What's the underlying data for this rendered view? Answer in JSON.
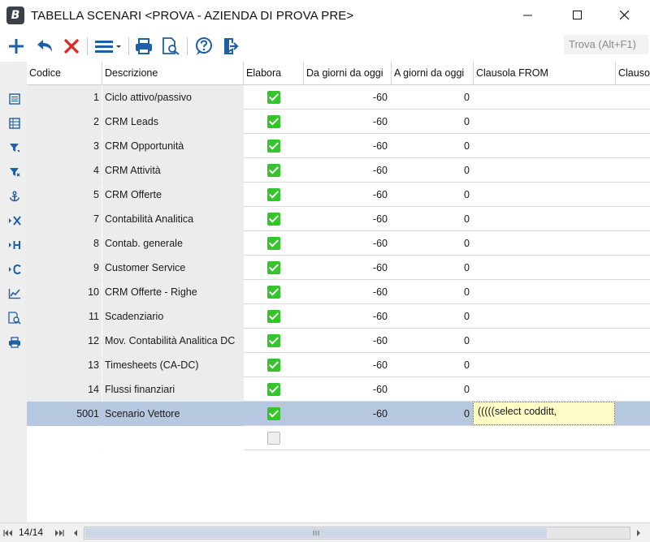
{
  "window": {
    "app_icon": "B",
    "title": "TABELLA SCENARI <PROVA - AZIENDA DI PROVA PRE>"
  },
  "toolbar": {
    "search_label": "Trova (Alt+F1)",
    "icons": [
      "add-icon",
      "undo-icon",
      "delete-icon",
      "menu-icon",
      "print-icon",
      "preview-icon",
      "help-icon",
      "exit-icon"
    ]
  },
  "grid": {
    "columns": [
      "Codice",
      "Descrizione",
      "Elabora",
      "Da giorni da oggi",
      "A giorni da oggi",
      "Clausola FROM",
      "Clausola"
    ],
    "rows": [
      {
        "code": "1",
        "desc": "Ciclo attivo/passivo",
        "elabora": true,
        "from": "-60",
        "to": "0",
        "clausola": ""
      },
      {
        "code": "2",
        "desc": "CRM Leads",
        "elabora": true,
        "from": "-60",
        "to": "0",
        "clausola": ""
      },
      {
        "code": "3",
        "desc": "CRM Opportunità",
        "elabora": true,
        "from": "-60",
        "to": "0",
        "clausola": ""
      },
      {
        "code": "4",
        "desc": "CRM Attività",
        "elabora": true,
        "from": "-60",
        "to": "0",
        "clausola": ""
      },
      {
        "code": "5",
        "desc": "CRM Offerte",
        "elabora": true,
        "from": "-60",
        "to": "0",
        "clausola": ""
      },
      {
        "code": "7",
        "desc": "Contabilità Analitica",
        "elabora": true,
        "from": "-60",
        "to": "0",
        "clausola": ""
      },
      {
        "code": "8",
        "desc": "Contab. generale",
        "elabora": true,
        "from": "-60",
        "to": "0",
        "clausola": ""
      },
      {
        "code": "9",
        "desc": "Customer Service",
        "elabora": true,
        "from": "-60",
        "to": "0",
        "clausola": ""
      },
      {
        "code": "10",
        "desc": "CRM Offerte - Righe",
        "elabora": true,
        "from": "-60",
        "to": "0",
        "clausola": ""
      },
      {
        "code": "11",
        "desc": "Scadenziario",
        "elabora": true,
        "from": "-60",
        "to": "0",
        "clausola": ""
      },
      {
        "code": "12",
        "desc": "Mov. Contabilità Analitica DC",
        "elabora": true,
        "from": "-60",
        "to": "0",
        "clausola": ""
      },
      {
        "code": "13",
        "desc": "Timesheets (CA-DC)",
        "elabora": true,
        "from": "-60",
        "to": "0",
        "clausola": ""
      },
      {
        "code": "14",
        "desc": "Flussi finanziari",
        "elabora": true,
        "from": "-60",
        "to": "0",
        "clausola": ""
      },
      {
        "code": "5001",
        "desc": "Scenario Vettore",
        "elabora": true,
        "from": "-60",
        "to": "0",
        "clausola": "(((((select codditt,",
        "selected": true
      },
      {
        "code": "",
        "desc": "",
        "elabora": false,
        "from": "",
        "to": "",
        "clausola": "",
        "new_row": true
      }
    ]
  },
  "sidebar": {
    "icons": [
      "list-icon",
      "table-icon",
      "filter-icon",
      "filter-clear-icon",
      "anchor-icon",
      "column-remove-icon",
      "column-hide-icon",
      "column-add-icon",
      "chart-icon",
      "zoom-preview-icon",
      "print-icon"
    ]
  },
  "status": {
    "record_count": "14/14"
  },
  "colors": {
    "check_green": "#36c42c",
    "selected_row": "#b5c8e0",
    "clausola_highlight": "#fdfbc6",
    "accent_blue": "#1f5fa8",
    "delete_red": "#e02424"
  }
}
